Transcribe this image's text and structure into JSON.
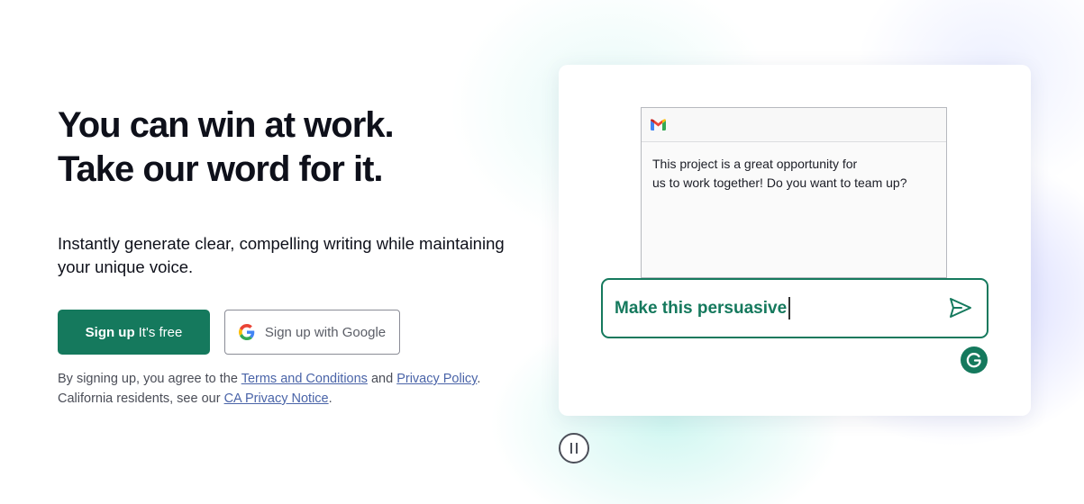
{
  "hero": {
    "headline_line1": "You can win at work.",
    "headline_line2": "Take our word for it.",
    "subtitle_line1": "Instantly generate clear, compelling writing while maintaining",
    "subtitle_line2": "your unique voice."
  },
  "buttons": {
    "signup_strong": "Sign up",
    "signup_free": "It's free",
    "google": "Sign up with Google"
  },
  "legal": {
    "prefix": "By signing up, you agree to the ",
    "terms": "Terms and Conditions",
    "and": " and ",
    "privacy": "Privacy Policy",
    "period": ".",
    "ca_prefix": "California residents, see our ",
    "ca_notice": "CA Privacy Notice",
    "ca_period": "."
  },
  "demo": {
    "email_line1": "This project is a great opportunity for",
    "email_line2": "us to work together! Do you want to team up?",
    "prompt": "Make this persuasive",
    "icons": [
      "gmail-icon",
      "send-icon",
      "grammarly-logo-icon",
      "pause-icon",
      "google-g-icon"
    ]
  },
  "colors": {
    "brand_green": "#15795d",
    "text_dark": "#0e101a",
    "link_blue": "#4a64a8"
  }
}
